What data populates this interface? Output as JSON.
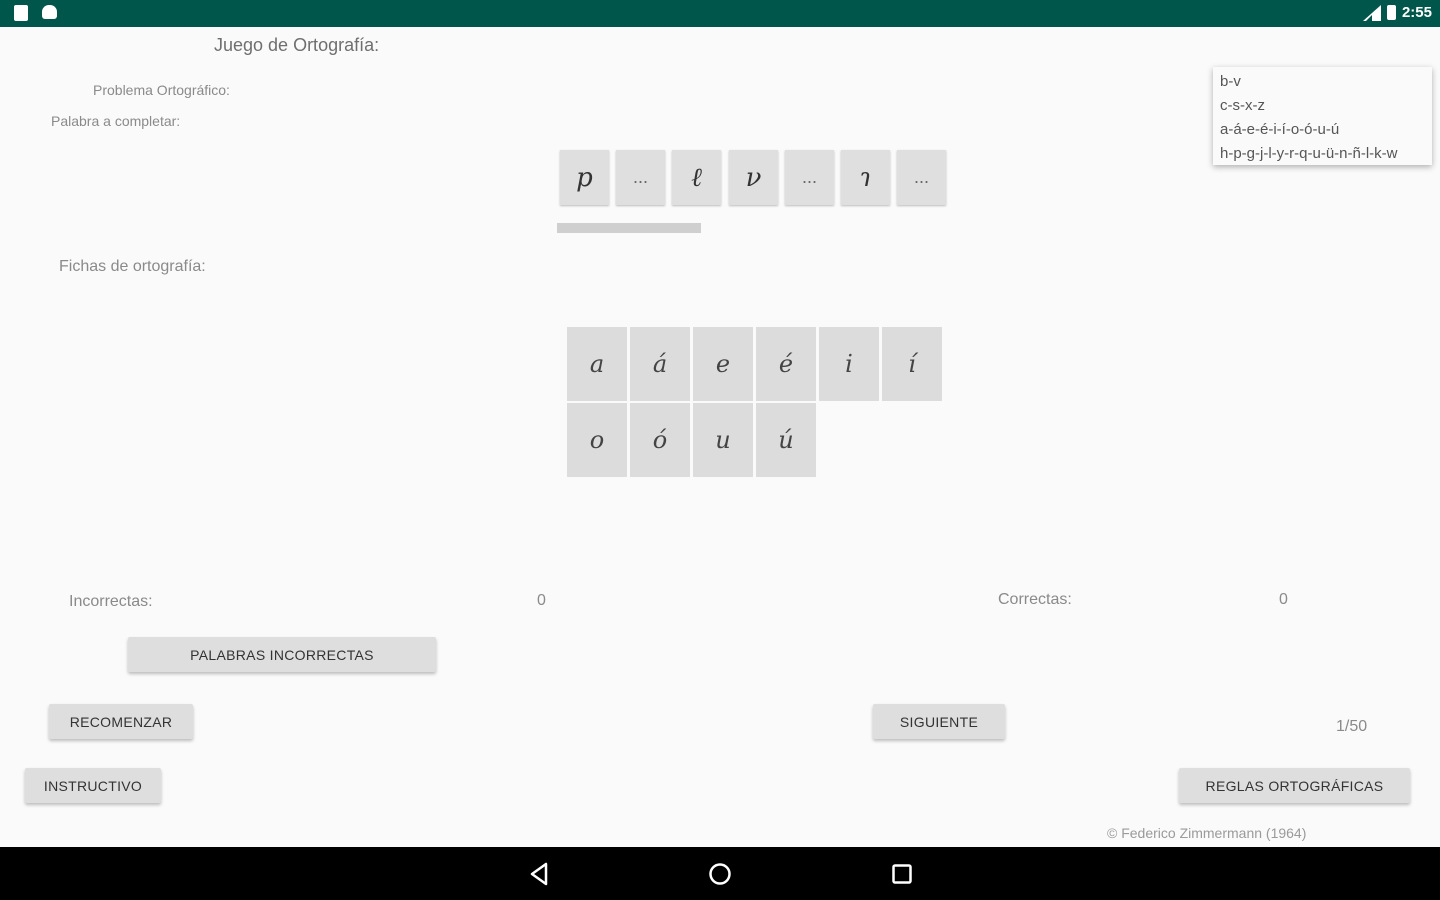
{
  "status_bar": {
    "time": "2:55"
  },
  "app": {
    "title": "Juego de Ortografía:",
    "problem_label": "Problema Ortográfico:",
    "word_label": "Palabra a completar:",
    "word_slots": [
      "p",
      "...",
      "ℓ",
      "ν",
      "...",
      "ɿ",
      "..."
    ],
    "progress_fraction": 0.26,
    "tiles_label": "Fichas de ortografía:",
    "tiles": [
      "a",
      "á",
      "e",
      "é",
      "i",
      "í",
      "o",
      "ó",
      "u",
      "ú"
    ]
  },
  "problem_menu": {
    "items": [
      "b-v",
      "c-s-x-z",
      "a-á-e-é-i-í-o-ó-u-ú",
      "h-p-g-j-l-y-r-q-u-ü-n-ñ-l-k-w"
    ]
  },
  "score": {
    "incorrect_label": "Incorrectas:",
    "incorrect_value": "0",
    "correct_label": "Correctas:",
    "correct_value": "0"
  },
  "buttons": {
    "wrong_words": "PALABRAS INCORRECTAS",
    "restart": "RECOMENZAR",
    "next": "SIGUIENTE",
    "instructions": "INSTRUCTIVO",
    "rules": "REGLAS ORTOGRÁFICAS"
  },
  "page_counter": "1/50",
  "copyright": "© Federico Zimmermann (1964)",
  "nav_bar": {
    "icons": [
      "back-icon",
      "home-icon",
      "recents-icon"
    ]
  }
}
